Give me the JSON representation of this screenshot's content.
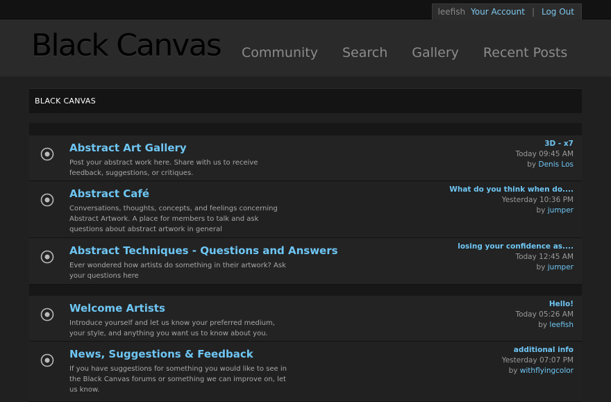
{
  "user": {
    "name": "leefish",
    "account_link": "Your Account",
    "separator": "|",
    "logout_link": "Log Out"
  },
  "site": {
    "logo": "Black Canvas"
  },
  "nav": [
    "Community",
    "Search",
    "Gallery",
    "Recent Posts"
  ],
  "breadcrumb": "BLACK CANVAS",
  "forums": [
    {
      "title": "Abstract Art Gallery",
      "description": "Post your abstract work here. Share with us to receive feedback, suggestions, or critiques.",
      "last_post": {
        "title": "3D - x7",
        "time": "Today 09:45 AM",
        "by_label": "by",
        "author": "Denis Los"
      }
    },
    {
      "title": "Abstract Café",
      "description": "Conversations, thoughts, concepts, and feelings concerning Abstract Artwork. A place for members to talk and ask questions about abstract artwork in general",
      "last_post": {
        "title": "What do you think when do....",
        "time": "Yesterday 10:36 PM",
        "by_label": "by",
        "author": "jumper"
      }
    },
    {
      "title": "Abstract Techniques - Questions and Answers",
      "description": "Ever wondered how artists do something in their artwork? Ask your questions here",
      "last_post": {
        "title": "losing your confidence as....",
        "time": "Today 12:45 AM",
        "by_label": "by",
        "author": "jumper"
      }
    },
    {
      "title": "Welcome Artists",
      "description": "Introduce yourself and let us know your preferred medium, your style, and anything you want us to know about you.",
      "last_post": {
        "title": "Hello!",
        "time": "Today 05:26 AM",
        "by_label": "by",
        "author": "leefish"
      }
    },
    {
      "title": "News, Suggestions & Feedback",
      "description": "If you have suggestions for something you would like to see in the Black Canvas forums or something we can improve on, let us know.",
      "last_post": {
        "title": "additional info",
        "time": "Yesterday 07:07 PM",
        "by_label": "by",
        "author": "withflyingcolor"
      }
    }
  ],
  "icons": {
    "forum_status": "forum-read-circle-icon"
  },
  "colors": {
    "link": "#6ec6f4",
    "background": "#202020",
    "header": "#2a2a2a"
  }
}
